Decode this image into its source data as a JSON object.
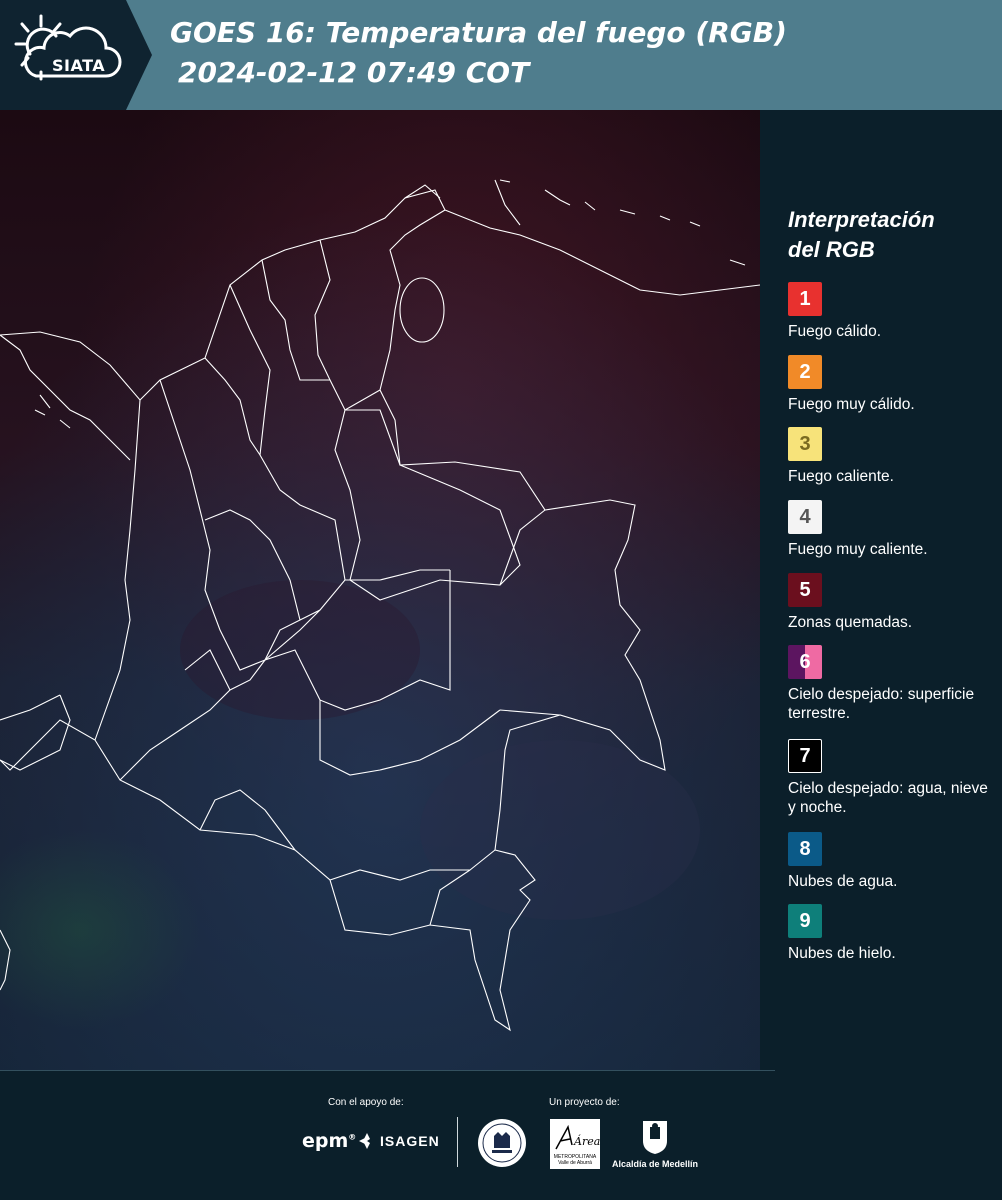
{
  "header": {
    "logo_text": "SIATA",
    "title_line1": "GOES 16: Temperatura del fuego (RGB)",
    "title_line2": "2024-02-12 07:49 COT",
    "colors": {
      "dark_band": "#0f2330",
      "title_band": "#4f7d8d"
    }
  },
  "map": {
    "description_icon": "satellite-map",
    "colors": {
      "background": "#1e1a2a",
      "border_lines": "#ffffff"
    }
  },
  "legend": {
    "title_line1": "Interpretación",
    "title_line2": "del RGB",
    "items": [
      {
        "number": "1",
        "label": "Fuego cálido.",
        "color": "#e8312f"
      },
      {
        "number": "2",
        "label": "Fuego muy cálido.",
        "color": "#f18a28"
      },
      {
        "number": "3",
        "label": "Fuego caliente.",
        "color": "#f7e37a"
      },
      {
        "number": "4",
        "label": "Fuego muy caliente.",
        "color": "#f4f4f4"
      },
      {
        "number": "5",
        "label": "Zonas quemadas.",
        "color": "#6b0f1e"
      },
      {
        "number": "6",
        "label": "Cielo despejado: superficie terrestre.",
        "color": "#5c1560",
        "color2": "#ef6aa3"
      },
      {
        "number": "7",
        "label": "Cielo despejado: agua, nieve y noche.",
        "color": "#000000"
      },
      {
        "number": "8",
        "label": "Nubes de agua.",
        "color": "#0b5a88"
      },
      {
        "number": "9",
        "label": "Nubes de hielo.",
        "color": "#0e7f7a"
      }
    ]
  },
  "footer": {
    "support_label": "Con el apoyo de:",
    "project_label": "Un proyecto de:",
    "epm": "epm",
    "epm_mark": "®",
    "isagen": "ISAGEN",
    "area_text1": "METROPOLITANA",
    "area_text2": "Valle de Aburrá",
    "area_script": "Área",
    "alcaldia": "Alcaldía de Medellín"
  }
}
